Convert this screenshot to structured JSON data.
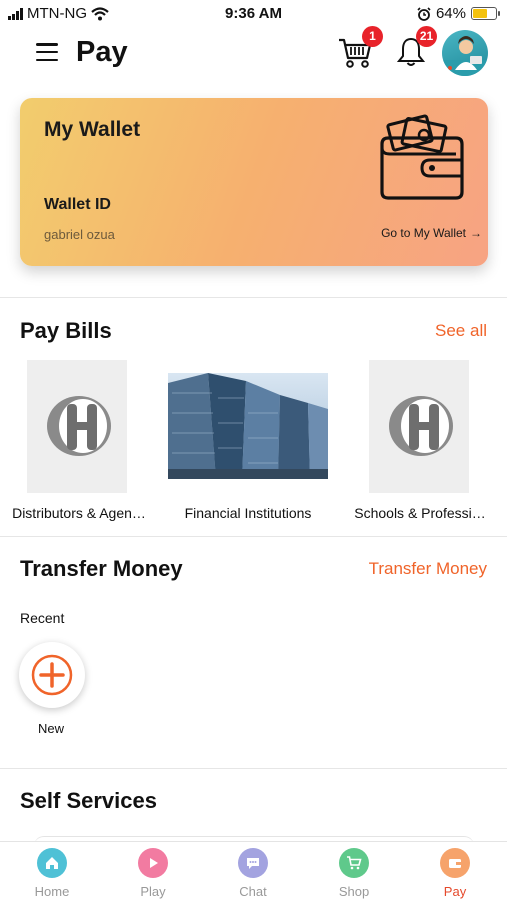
{
  "status_bar": {
    "carrier": "MTN-NG",
    "time": "9:36 AM",
    "battery": "64%",
    "battery_level": 0.64
  },
  "header": {
    "title": "Pay",
    "cart_count": "1",
    "notification_count": "21"
  },
  "wallet": {
    "title": "My Wallet",
    "id_label": "Wallet ID",
    "user": "gabriel ozua",
    "link": "Go to My Wallet",
    "link_arrow": "→"
  },
  "pay_bills": {
    "title": "Pay Bills",
    "see_all": "See all",
    "items": [
      {
        "label": "Distributors & Agen…"
      },
      {
        "label": "Financial Institutions"
      },
      {
        "label": "Schools & Professi…"
      }
    ]
  },
  "transfer": {
    "title": "Transfer Money",
    "link": "Transfer Money",
    "recent": "Recent",
    "new_label": "New"
  },
  "self_services": {
    "title": "Self Services"
  },
  "bottom_nav": {
    "items": [
      {
        "label": "Home",
        "icon": "home-icon",
        "color": "#4fc1d6"
      },
      {
        "label": "Play",
        "icon": "play-icon",
        "color": "#f27ba1"
      },
      {
        "label": "Chat",
        "icon": "chat-icon",
        "color": "#a3a3e0"
      },
      {
        "label": "Shop",
        "icon": "cart-icon",
        "color": "#5fc98b"
      },
      {
        "label": "Pay",
        "icon": "wallet-icon",
        "color": "#f6a36b"
      }
    ],
    "active": "Pay"
  },
  "colors": {
    "accent": "#f0642a",
    "badge": "#e8232a"
  }
}
